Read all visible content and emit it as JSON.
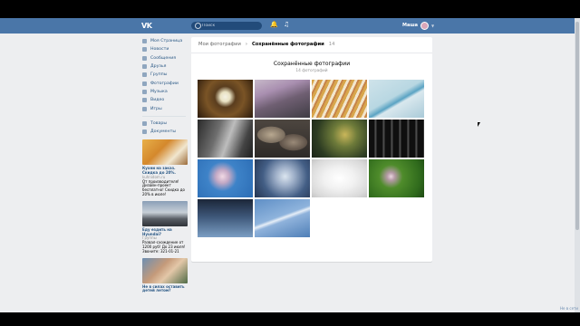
{
  "header": {
    "logo": "VK",
    "search_placeholder": "Поиск",
    "user_name": "Маша"
  },
  "sidebar": {
    "items": [
      {
        "label": "Моя Страница",
        "icon": "home-icon"
      },
      {
        "label": "Новости",
        "icon": "news-icon"
      },
      {
        "label": "Сообщения",
        "icon": "messages-icon"
      },
      {
        "label": "Друзья",
        "icon": "friends-icon"
      },
      {
        "label": "Группы",
        "icon": "groups-icon"
      },
      {
        "label": "Фотографии",
        "icon": "photos-icon"
      },
      {
        "label": "Музыка",
        "icon": "music-icon"
      },
      {
        "label": "Видео",
        "icon": "video-icon"
      },
      {
        "label": "Игры",
        "icon": "games-icon"
      }
    ],
    "items2": [
      {
        "label": "Товары",
        "icon": "market-icon"
      },
      {
        "label": "Документы",
        "icon": "documents-icon"
      }
    ],
    "ads": [
      {
        "title": "Кухни на заказ. Скидка до 20%.",
        "domain": "kuhnidom.ru",
        "body": "От производителя! Дизайн-проект бесплатно! Скидка до 20% в июле!"
      },
      {
        "title": "Еду ездить на Hyundai?",
        "domain": "Группы",
        "body": "Развал-схождение от 1200 руб! До 23 июля! Звоните: 321-01-21"
      },
      {
        "title": "Не в силах оставить детей летом?",
        "domain": "",
        "body": ""
      }
    ]
  },
  "main": {
    "breadcrumb_parent": "Мои фотографии",
    "breadcrumb_current": "Сохранённые фотографии",
    "breadcrumb_count": "14",
    "album_title": "Сохранённые фотографии",
    "album_subtitle": "14 фотографий",
    "photos": [
      {
        "name": "daisy-photo"
      },
      {
        "name": "forest-path-photo"
      },
      {
        "name": "pencils-photo"
      },
      {
        "name": "blue-pencil-photo"
      },
      {
        "name": "bw-scene-photo"
      },
      {
        "name": "pebbles-photo"
      },
      {
        "name": "leaves-bokeh-photo"
      },
      {
        "name": "bottles-photo"
      },
      {
        "name": "blossom-sky-photo"
      },
      {
        "name": "hand-flowers-photo"
      },
      {
        "name": "earphones-photo"
      },
      {
        "name": "clover-flower-photo"
      },
      {
        "name": "branches-sky-photo"
      },
      {
        "name": "contrail-sky-photo"
      }
    ]
  },
  "footer": {
    "help": "Не в сети"
  }
}
